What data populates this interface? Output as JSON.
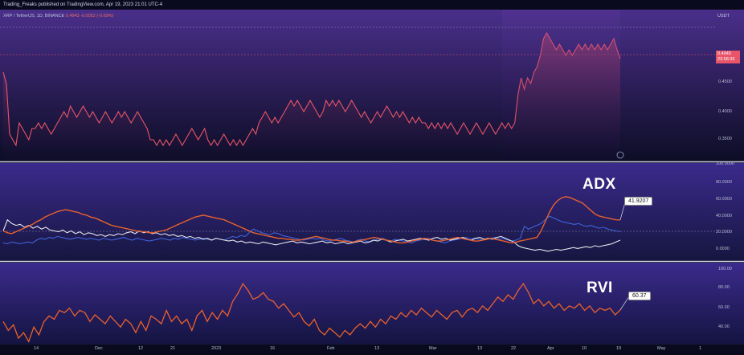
{
  "header": {
    "published": "Trading_Freaks published on TradingView.com, Apr 19, 2023 21:01 UTC-4",
    "symbol": "XRP / TetherUS, 1D, BINANCE",
    "last_change": "0.4943 -0.0052 (-0.69%)",
    "currency": "USDT"
  },
  "price_badge": {
    "price": "0.4943",
    "countdown": "23:58:36"
  },
  "colors": {
    "background": "#0a0a1e",
    "price_line": "#e8556a",
    "adx_line": "#e8612c",
    "plus_di": "#3f63d9",
    "minus_di": "#e6e6ee",
    "rvi_line": "#e8612c",
    "divider": "#cfd2e6"
  },
  "chart_data": [
    {
      "type": "line",
      "panel": "price",
      "series": [
        {
          "name": "XRP / TetherUS",
          "values": [
            0.47,
            0.45,
            0.36,
            0.35,
            0.34,
            0.38,
            0.37,
            0.36,
            0.35,
            0.37,
            0.37,
            0.38,
            0.37,
            0.38,
            0.37,
            0.36,
            0.37,
            0.38,
            0.39,
            0.4,
            0.39,
            0.41,
            0.4,
            0.39,
            0.4,
            0.41,
            0.4,
            0.39,
            0.4,
            0.39,
            0.38,
            0.39,
            0.4,
            0.39,
            0.38,
            0.39,
            0.4,
            0.39,
            0.4,
            0.39,
            0.38,
            0.39,
            0.4,
            0.39,
            0.38,
            0.37,
            0.35,
            0.35,
            0.34,
            0.35,
            0.34,
            0.35,
            0.34,
            0.35,
            0.36,
            0.35,
            0.34,
            0.35,
            0.36,
            0.37,
            0.36,
            0.35,
            0.36,
            0.37,
            0.35,
            0.34,
            0.35,
            0.34,
            0.35,
            0.36,
            0.35,
            0.34,
            0.35,
            0.34,
            0.35,
            0.34,
            0.35,
            0.36,
            0.37,
            0.36,
            0.38,
            0.39,
            0.4,
            0.39,
            0.38,
            0.39,
            0.38,
            0.39,
            0.4,
            0.41,
            0.42,
            0.41,
            0.42,
            0.41,
            0.4,
            0.41,
            0.42,
            0.41,
            0.4,
            0.39,
            0.4,
            0.42,
            0.41,
            0.42,
            0.41,
            0.42,
            0.41,
            0.4,
            0.41,
            0.42,
            0.41,
            0.4,
            0.39,
            0.4,
            0.39,
            0.38,
            0.39,
            0.4,
            0.39,
            0.4,
            0.41,
            0.4,
            0.39,
            0.4,
            0.39,
            0.4,
            0.39,
            0.38,
            0.39,
            0.38,
            0.39,
            0.38,
            0.38,
            0.37,
            0.38,
            0.37,
            0.38,
            0.37,
            0.38,
            0.37,
            0.38,
            0.37,
            0.36,
            0.37,
            0.38,
            0.37,
            0.36,
            0.37,
            0.38,
            0.37,
            0.36,
            0.37,
            0.38,
            0.37,
            0.36,
            0.37,
            0.38,
            0.37,
            0.38,
            0.37,
            0.38,
            0.43,
            0.46,
            0.44,
            0.46,
            0.45,
            0.47,
            0.48,
            0.5,
            0.53,
            0.54,
            0.53,
            0.52,
            0.51,
            0.52,
            0.51,
            0.5,
            0.51,
            0.5,
            0.51,
            0.52,
            0.51,
            0.52,
            0.51,
            0.52,
            0.51,
            0.52,
            0.51,
            0.52,
            0.51,
            0.52,
            0.53,
            0.51,
            0.4943
          ]
        }
      ],
      "y_ticks": [
        "0.4500",
        "0.4000",
        "0.3500"
      ],
      "ylim": [
        0.33,
        0.55
      ]
    },
    {
      "type": "line",
      "panel": "ADX",
      "title": "ADX",
      "last_value": "41.9207",
      "series": [
        {
          "values": [
            30,
            28,
            27,
            29,
            31,
            33,
            35,
            37,
            40,
            42,
            45,
            47,
            49,
            51,
            52,
            53,
            52,
            51,
            50,
            48,
            47,
            45,
            44,
            42,
            40,
            38,
            36,
            35,
            34,
            33,
            32,
            31,
            30,
            29,
            29,
            28,
            28,
            29,
            30,
            31,
            33,
            35,
            37,
            39,
            41,
            43,
            45,
            46,
            47,
            46,
            45,
            44,
            43,
            42,
            40,
            38,
            36,
            34,
            32,
            30,
            28,
            27,
            26,
            25,
            24,
            23,
            22,
            22,
            21,
            21,
            20,
            20,
            21,
            22,
            23,
            24,
            23,
            22,
            21,
            20,
            20,
            19,
            19,
            18,
            18,
            19,
            20,
            21,
            22,
            23,
            22,
            21,
            20,
            19,
            18,
            17,
            17,
            18,
            19,
            20,
            21,
            22,
            21,
            20,
            19,
            19,
            20,
            21,
            22,
            23,
            22,
            21,
            20,
            19,
            19,
            20,
            21,
            22,
            21,
            20,
            19,
            18,
            17,
            18,
            19,
            20,
            21,
            22,
            23,
            30,
            40,
            50,
            58,
            63,
            66,
            67,
            66,
            64,
            62,
            60,
            56,
            52,
            48,
            46,
            45,
            44,
            43,
            42,
            41.9207
          ]
        },
        {
          "values": [
            17,
            16,
            18,
            17,
            16,
            17,
            18,
            17,
            20,
            22,
            21,
            23,
            22,
            24,
            23,
            22,
            21,
            22,
            23,
            22,
            21,
            22,
            21,
            20,
            22,
            21,
            20,
            21,
            22,
            23,
            21,
            20,
            22,
            21,
            20,
            19,
            20,
            21,
            22,
            21,
            20,
            22,
            21,
            23,
            22,
            21,
            20,
            21,
            22,
            21,
            20,
            22,
            21,
            20,
            22,
            24,
            23,
            25,
            24,
            28,
            32,
            30,
            28,
            27,
            26,
            28,
            27,
            25,
            24,
            23,
            22,
            21,
            20,
            21,
            22,
            21,
            22,
            20,
            19,
            20,
            21,
            22,
            20,
            19,
            18,
            20,
            21,
            19,
            18,
            20,
            21,
            22,
            20,
            19,
            21,
            20,
            19,
            18,
            17,
            19,
            20,
            21,
            22,
            20,
            19,
            18,
            17,
            19,
            20,
            21,
            22,
            23,
            21,
            22,
            21,
            20,
            21,
            22,
            23,
            21,
            22,
            20,
            19,
            20,
            22,
            35,
            32,
            34,
            36,
            38,
            42,
            46,
            44,
            42,
            40,
            39,
            38,
            37,
            38,
            36,
            35,
            36,
            34,
            33,
            34,
            32,
            31,
            30,
            29
          ]
        },
        {
          "values": [
            30,
            42,
            38,
            36,
            37,
            34,
            36,
            33,
            35,
            32,
            34,
            31,
            30,
            29,
            31,
            28,
            30,
            27,
            29,
            26,
            28,
            27,
            25,
            26,
            24,
            26,
            25,
            27,
            26,
            28,
            29,
            27,
            30,
            28,
            29,
            27,
            28,
            26,
            27,
            25,
            26,
            24,
            25,
            23,
            24,
            22,
            23,
            21,
            22,
            20,
            22,
            21,
            20,
            19,
            20,
            18,
            19,
            17,
            18,
            17,
            16,
            18,
            17,
            16,
            15,
            16,
            17,
            18,
            19,
            17,
            18,
            17,
            16,
            17,
            18,
            19,
            17,
            18,
            16,
            17,
            18,
            16,
            17,
            18,
            19,
            17,
            18,
            20,
            19,
            21,
            20,
            18,
            19,
            20,
            21,
            19,
            20,
            21,
            22,
            21,
            20,
            22,
            23,
            21,
            22,
            20,
            21,
            22,
            23,
            21,
            20,
            22,
            23,
            21,
            22,
            21,
            23,
            24,
            22,
            20,
            18,
            14,
            12,
            11,
            10,
            9,
            10,
            9,
            8,
            9,
            10,
            9,
            10,
            11,
            12,
            11,
            12,
            13,
            12,
            14,
            13,
            14,
            15,
            16,
            18,
            20
          ]
        }
      ],
      "y_ticks": [
        "100.0000",
        "80.0000",
        "60.0000",
        "40.0000",
        "20.0000",
        "0.0000"
      ],
      "ylim": [
        0,
        100
      ]
    },
    {
      "type": "line",
      "panel": "RVI",
      "title": "RVI",
      "last_value": "60.37",
      "series": [
        {
          "values": [
            50,
            42,
            47,
            35,
            40,
            32,
            45,
            38,
            50,
            55,
            52,
            60,
            58,
            62,
            55,
            60,
            58,
            50,
            56,
            52,
            48,
            55,
            50,
            45,
            52,
            48,
            40,
            50,
            42,
            55,
            52,
            48,
            60,
            50,
            55,
            48,
            52,
            42,
            55,
            60,
            50,
            58,
            52,
            60,
            55,
            68,
            75,
            84,
            78,
            70,
            72,
            76,
            70,
            68,
            62,
            66,
            60,
            54,
            58,
            50,
            46,
            52,
            42,
            38,
            44,
            40,
            36,
            42,
            38,
            44,
            48,
            44,
            50,
            45,
            52,
            48,
            55,
            52,
            58,
            54,
            60,
            56,
            62,
            58,
            54,
            60,
            56,
            52,
            58,
            60,
            54,
            60,
            62,
            58,
            64,
            60,
            66,
            72,
            68,
            74,
            70,
            78,
            84,
            76,
            66,
            70,
            64,
            68,
            62,
            66,
            60,
            64,
            62,
            66,
            60,
            64,
            58,
            62,
            60,
            62,
            56,
            60.37
          ]
        }
      ],
      "y_ticks": [
        "100.00",
        "80.00",
        "60.00",
        "40.00"
      ],
      "ylim": [
        30,
        100
      ]
    }
  ],
  "x_dates": [
    "14",
    "Dec",
    "12",
    "21",
    "2023",
    "16",
    "Feb",
    "13",
    "Mar",
    "13",
    "22",
    "Apr",
    "10",
    "19",
    "May",
    "1"
  ]
}
